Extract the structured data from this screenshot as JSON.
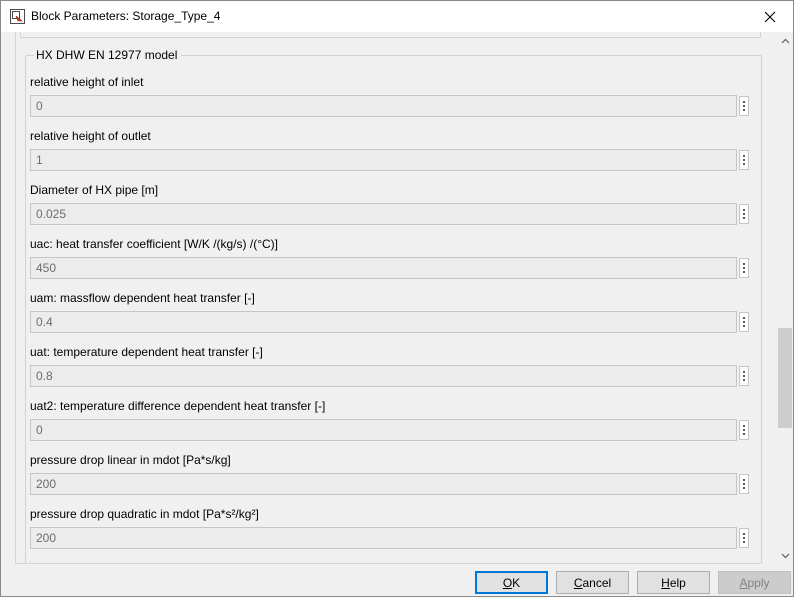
{
  "window": {
    "title": "Block Parameters: Storage_Type_4"
  },
  "group": {
    "title": "HX DHW EN 12977 model"
  },
  "params": [
    {
      "label": "relative height of inlet",
      "value": "0"
    },
    {
      "label": "relative height of outlet",
      "value": "1"
    },
    {
      "label": "Diameter of HX pipe [m]",
      "value": "0.025"
    },
    {
      "label": "uac: heat transfer coefficient [W/K /(kg/s) /(°C)]",
      "value": "450"
    },
    {
      "label": "uam: massflow dependent heat transfer [-]",
      "value": "0.4"
    },
    {
      "label": "uat: temperature dependent heat transfer [-]",
      "value": "0.8"
    },
    {
      "label": "uat2: temperature difference dependent heat transfer [-]",
      "value": "0"
    },
    {
      "label": "pressure drop linear in mdot [Pa*s/kg]",
      "value": "200"
    },
    {
      "label": "pressure drop quadratic in mdot [Pa*s²/kg²]",
      "value": "200"
    }
  ],
  "buttons": {
    "ok": {
      "mnemonic": "O",
      "rest": "K"
    },
    "cancel": {
      "mnemonic": "C",
      "rest": "ancel"
    },
    "help": {
      "mnemonic": "H",
      "rest": "elp"
    },
    "apply": {
      "mnemonic": "A",
      "rest": "pply"
    }
  },
  "colors": {
    "window_bg": "#f0f0f0",
    "field_bg": "#ececec",
    "accent": "#0078d7",
    "disabled_text": "#838383"
  },
  "scrollbar": {
    "position_fraction": 0.7
  }
}
